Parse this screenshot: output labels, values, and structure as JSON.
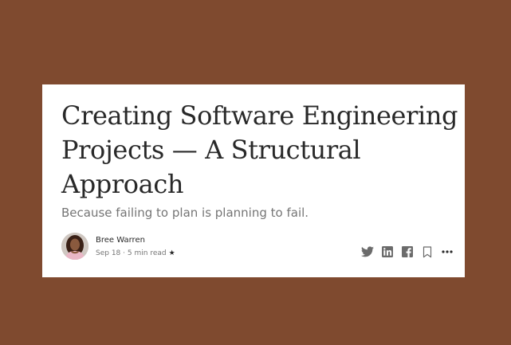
{
  "article": {
    "title": "Creating Software Engineering Projects — A Structural Approach",
    "subtitle": "Because failing to plan is planning to fail.",
    "author": {
      "name": "Bree Warren",
      "avatar_icon": "author-photo"
    },
    "date": "Sep 18",
    "separator": "·",
    "read_time": "5 min read",
    "member_badge": "★"
  },
  "actions": {
    "items": [
      {
        "name": "twitter-icon"
      },
      {
        "name": "linkedin-icon"
      },
      {
        "name": "facebook-icon"
      },
      {
        "name": "bookmark-icon"
      },
      {
        "name": "more-icon"
      }
    ]
  },
  "colors": {
    "background": "#7f4a2f",
    "card": "#ffffff",
    "text_primary": "#292929",
    "text_secondary": "#757575",
    "icon": "#6b6b6b"
  }
}
